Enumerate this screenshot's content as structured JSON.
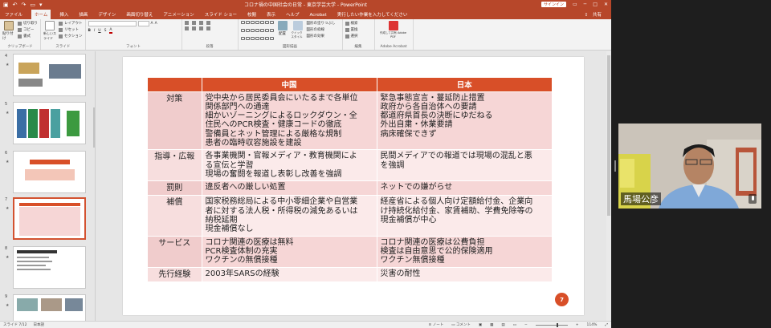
{
  "window": {
    "title": "コロナ禍の中国社会の日常 - 東京学芸大学 - PowerPoint",
    "signin": "サインイン",
    "share": "共有"
  },
  "tabs": [
    "ファイル",
    "ホーム",
    "挿入",
    "描画",
    "デザイン",
    "画面切り替え",
    "アニメーション",
    "スライド ショー",
    "校閲",
    "表示",
    "ヘルプ",
    "Acrobat",
    "実行したい作業を入力してください"
  ],
  "active_tab": "ホーム",
  "ribbon": {
    "groups": [
      "クリップボード",
      "スライド",
      "フォント",
      "段落",
      "図形描画",
      "編集",
      "Adobe Acrobat"
    ],
    "paste": "貼り付け",
    "cut": "切り取り",
    "copy": "コピー",
    "format_painter": "書式のコピー/貼り付け",
    "new_slide": "新しいスライド",
    "layout": "レイアウト",
    "reset": "リセット",
    "section": "セクション",
    "arrange": "配置",
    "quick_styles": "クイック スタイル",
    "shape_fill": "図形の塗りつぶし",
    "shape_outline": "図形の枠線",
    "shape_effects": "図形の効果",
    "find": "検索",
    "replace": "置換",
    "select": "選択",
    "adobe_share": "作成して共有 Adobe PDF",
    "font_color": "#c00000"
  },
  "thumbnails": [
    {
      "num": "4",
      "star": "★"
    },
    {
      "num": "5",
      "star": "★"
    },
    {
      "num": "6",
      "star": "★"
    },
    {
      "num": "7",
      "star": "★",
      "selected": true
    },
    {
      "num": "8",
      "star": "★"
    },
    {
      "num": "9",
      "star": "★"
    }
  ],
  "table": {
    "headers": [
      "",
      "中国",
      "日本"
    ],
    "rows": [
      {
        "category": "対策",
        "china": "党中央から居民委員会にいたるまで各単位\n関係部門への通達\n細かいゾーニングによるロックダウン・全\n住民へのPCR検査・健康コードの徹底\n警備員とネット管理による厳格な規制\n患者の臨時収容施設を建設",
        "japan": "緊急事態宣言・蔓延防止措置\n政府から各自治体への要請\n都道府県首長の決断にゆだねる\n外出自粛・休業要請\n病床確保できず"
      },
      {
        "category": "指導・広報",
        "china": "各事業機関・官報メディア・教育機関によ\nる宣伝と学習\n現場の奮闘を報道し表彰し改善を強調",
        "japan": "民間メディアでの報道では現場の混乱と悪\nを強調"
      },
      {
        "category": "罰則",
        "china": "違反者への厳しい処置",
        "japan": "ネットでの嫌がらせ"
      },
      {
        "category": "補償",
        "china": "国家税務総局による中小零細企業や自営業\n者に対する法人税・所得税の減免あるいは\n納税延期\n現金補償なし",
        "japan": "経産省による個人向け定額給付金、企業向\nけ持続化給付金、家賃補助、学費免除等の\n現金補償が中心"
      },
      {
        "category": "サービス",
        "china": "コロナ関連の医療は無料\nPCR検査体制の充実\nワクチンの無償接種",
        "japan": "コロナ関連の医療は公費負担\n検査は自由意思で公的保険適用\nワクチン無償接種"
      },
      {
        "category": "先行経験",
        "china": "2003年SARSの経験",
        "japan": "災害の耐性"
      }
    ]
  },
  "page_number": "7",
  "status": {
    "slide": "スライド 7/12",
    "lang": "日本語",
    "notes": "ノート",
    "comments": "コメント",
    "zoom": "114%"
  },
  "video": {
    "name": "馬場公彦"
  },
  "colors": {
    "accent": "#b7472a",
    "table_header": "#d84f28",
    "row_odd": "#f6d6d6",
    "row_even": "#fbeaea"
  }
}
